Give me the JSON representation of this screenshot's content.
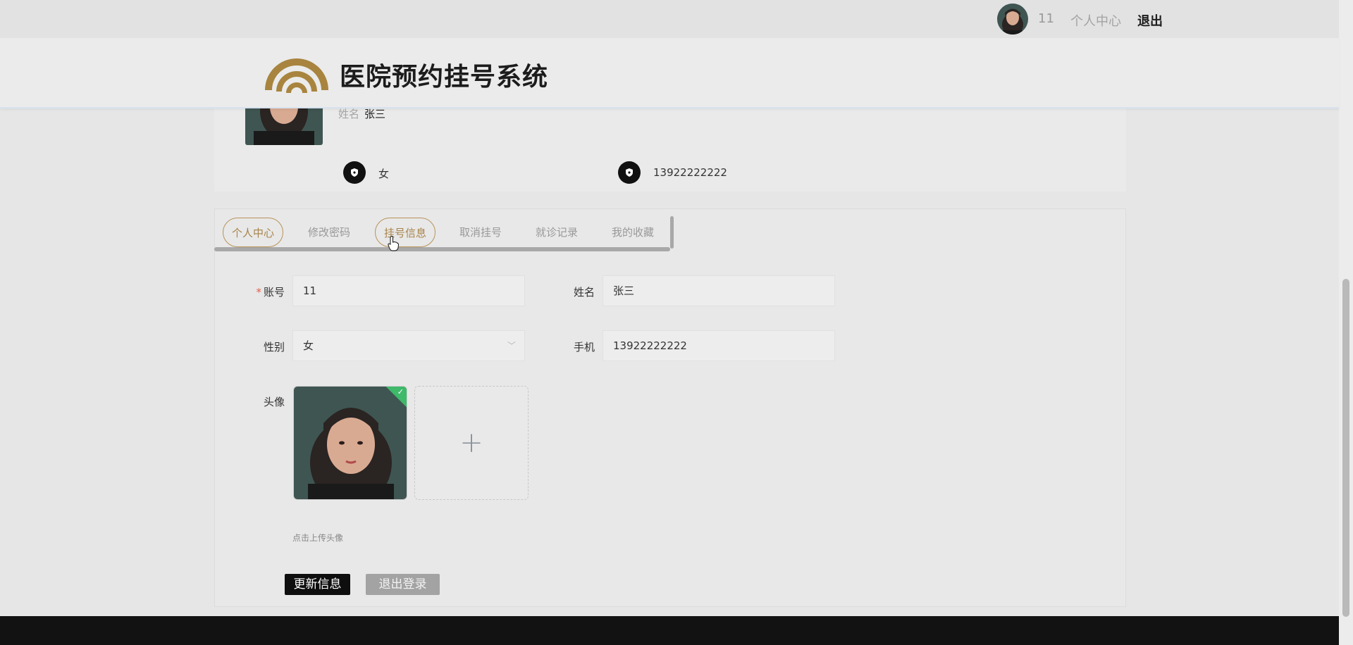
{
  "topbar": {
    "username": "11",
    "center_link": "个人中心",
    "logout_link": "退出"
  },
  "header": {
    "title": "医院预约挂号系统"
  },
  "profile": {
    "name_label": "姓名",
    "name_value": "张三",
    "gender": "女",
    "phone": "13922222222"
  },
  "tabs": [
    {
      "label": "个人中心",
      "active": true
    },
    {
      "label": "修改密码",
      "active": false
    },
    {
      "label": "挂号信息",
      "active": true
    },
    {
      "label": "取消挂号",
      "active": false
    },
    {
      "label": "就诊记录",
      "active": false
    },
    {
      "label": "我的收藏",
      "active": false
    }
  ],
  "form": {
    "account": {
      "label": "账号",
      "required_mark": "*",
      "value": "11"
    },
    "name": {
      "label": "姓名",
      "value": "张三"
    },
    "gender": {
      "label": "性别",
      "value": "女"
    },
    "phone": {
      "label": "手机",
      "value": "13922222222"
    },
    "avatar": {
      "label": "头像",
      "upload_hint": "点击上传头像",
      "plus_icon": "+"
    }
  },
  "buttons": {
    "update": "更新信息",
    "logout": "退出登录"
  },
  "colors": {
    "accent_gold": "#b8935a",
    "success_green": "#3fb96a",
    "dark": "#0e0e0e"
  }
}
